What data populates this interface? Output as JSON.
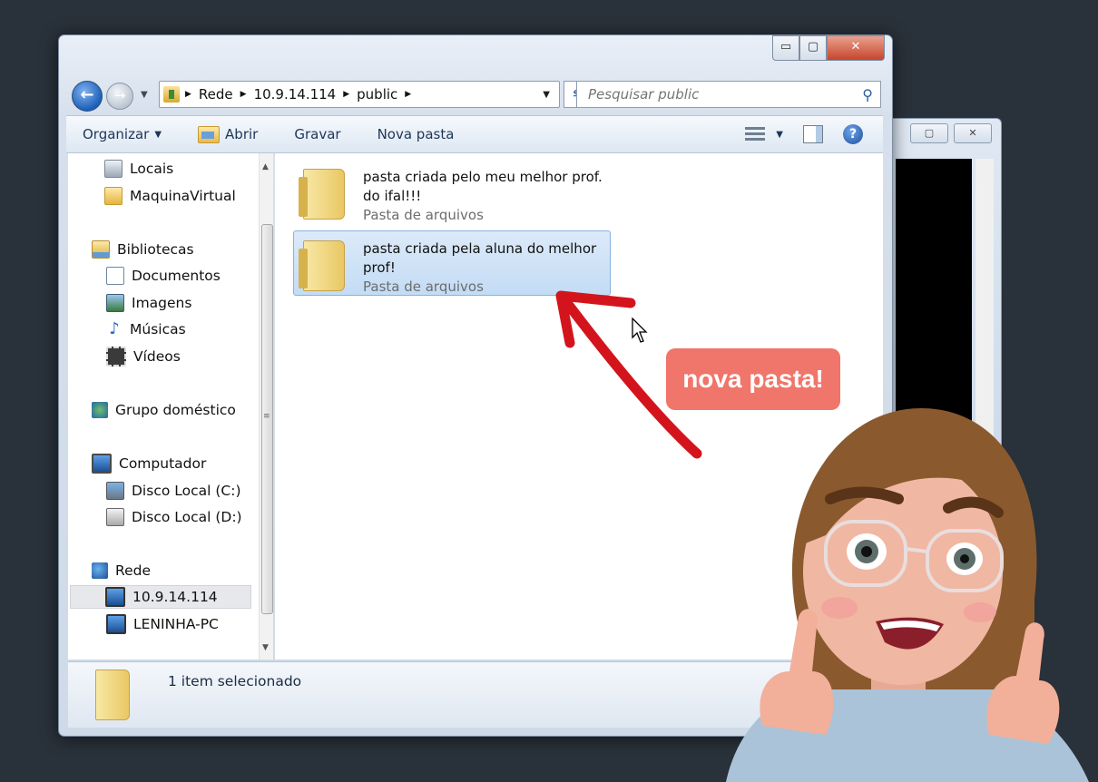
{
  "window": {
    "caption_buttons": {
      "minimize": "▭",
      "maximize": "▢",
      "close": "✕"
    }
  },
  "address_bar": {
    "crumbs": [
      "Rede",
      "10.9.14.114",
      "public"
    ],
    "search_placeholder": "Pesquisar public"
  },
  "command_bar": {
    "organize": "Organizar",
    "open": "Abrir",
    "burn": "Gravar",
    "new_folder": "Nova pasta"
  },
  "nav_pane": {
    "items": [
      {
        "label": "Locais",
        "icon": "recent-places-icon"
      },
      {
        "label": "MaquinaVirtual",
        "icon": "folder-icon"
      },
      {
        "label": "Bibliotecas",
        "icon": "libraries-icon"
      },
      {
        "label": "Documentos",
        "icon": "documents-icon"
      },
      {
        "label": "Imagens",
        "icon": "pictures-icon"
      },
      {
        "label": "Músicas",
        "icon": "music-icon"
      },
      {
        "label": "Vídeos",
        "icon": "videos-icon"
      },
      {
        "label": "Grupo doméstico",
        "icon": "homegroup-icon"
      },
      {
        "label": "Computador",
        "icon": "computer-icon"
      },
      {
        "label": "Disco Local (C:)",
        "icon": "drive-c-icon"
      },
      {
        "label": "Disco Local (D:)",
        "icon": "drive-d-icon"
      },
      {
        "label": "Rede",
        "icon": "network-icon"
      },
      {
        "label": "10.9.14.114",
        "icon": "network-computer-icon"
      },
      {
        "label": "LENINHA-PC",
        "icon": "network-computer-icon"
      }
    ]
  },
  "files": [
    {
      "name_line1": "pasta criada pelo meu melhor prof.",
      "name_line2": "do ifal!!!",
      "type": "Pasta de arquivos",
      "selected": false
    },
    {
      "name_line1": "pasta criada pela aluna do melhor",
      "name_line2": "prof!",
      "type": "Pasta de arquivos",
      "selected": true
    }
  ],
  "details_pane": {
    "status": "1 item selecionado"
  },
  "annotation": {
    "callout": "nova pasta!",
    "arrow_color": "#d4141c",
    "callout_color": "#f0756a"
  }
}
